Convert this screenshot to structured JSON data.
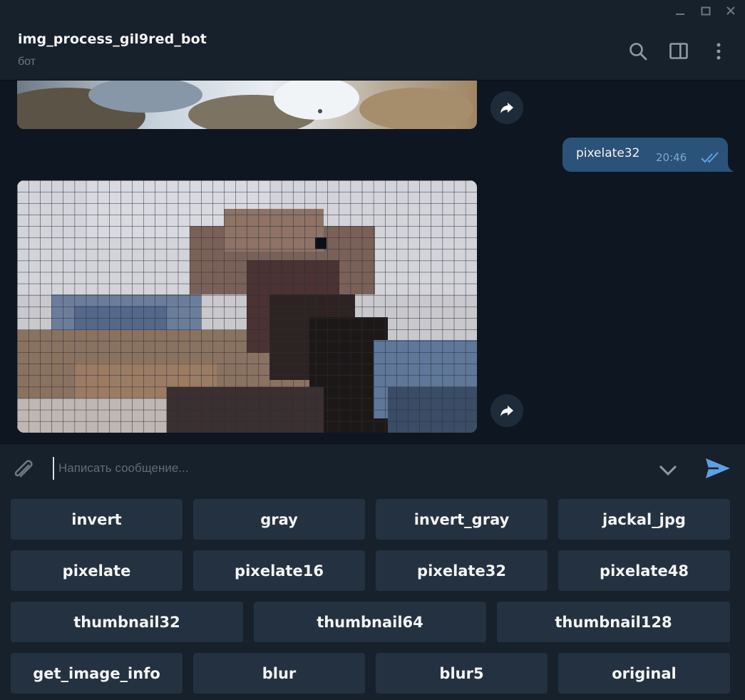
{
  "window": {
    "minimize_icon": "minimize-icon",
    "maximize_icon": "maximize-icon",
    "close_icon": "close-icon"
  },
  "header": {
    "title": "img_process_gil9red_bot",
    "status": "бот",
    "icons": [
      "search-icon",
      "sidebar-toggle-icon",
      "more-vertical-icon"
    ]
  },
  "messages": {
    "outgoing": {
      "text": "pixelate32",
      "time": "20:46",
      "status_icon": "double-check-icon"
    },
    "forward_icon": "share-arrow-icon"
  },
  "composer": {
    "placeholder": "Написать сообщение...",
    "value": "",
    "attach_icon": "paperclip-icon",
    "keyboard_toggle_icon": "chevron-down-icon",
    "send_icon": "send-icon"
  },
  "keyboard": {
    "rows": [
      [
        "invert",
        "gray",
        "invert_gray",
        "jackal_jpg"
      ],
      [
        "pixelate",
        "pixelate16",
        "pixelate32",
        "pixelate48"
      ],
      [
        "thumbnail32",
        "thumbnail64",
        "thumbnail128"
      ],
      [
        "get_image_info",
        "blur",
        "blur5",
        "original"
      ]
    ]
  },
  "colors": {
    "background": "#0e1621",
    "panel": "#17212b",
    "button": "#243140",
    "outgoing_bubble": "#2b5278",
    "accent": "#5ea0e4"
  }
}
